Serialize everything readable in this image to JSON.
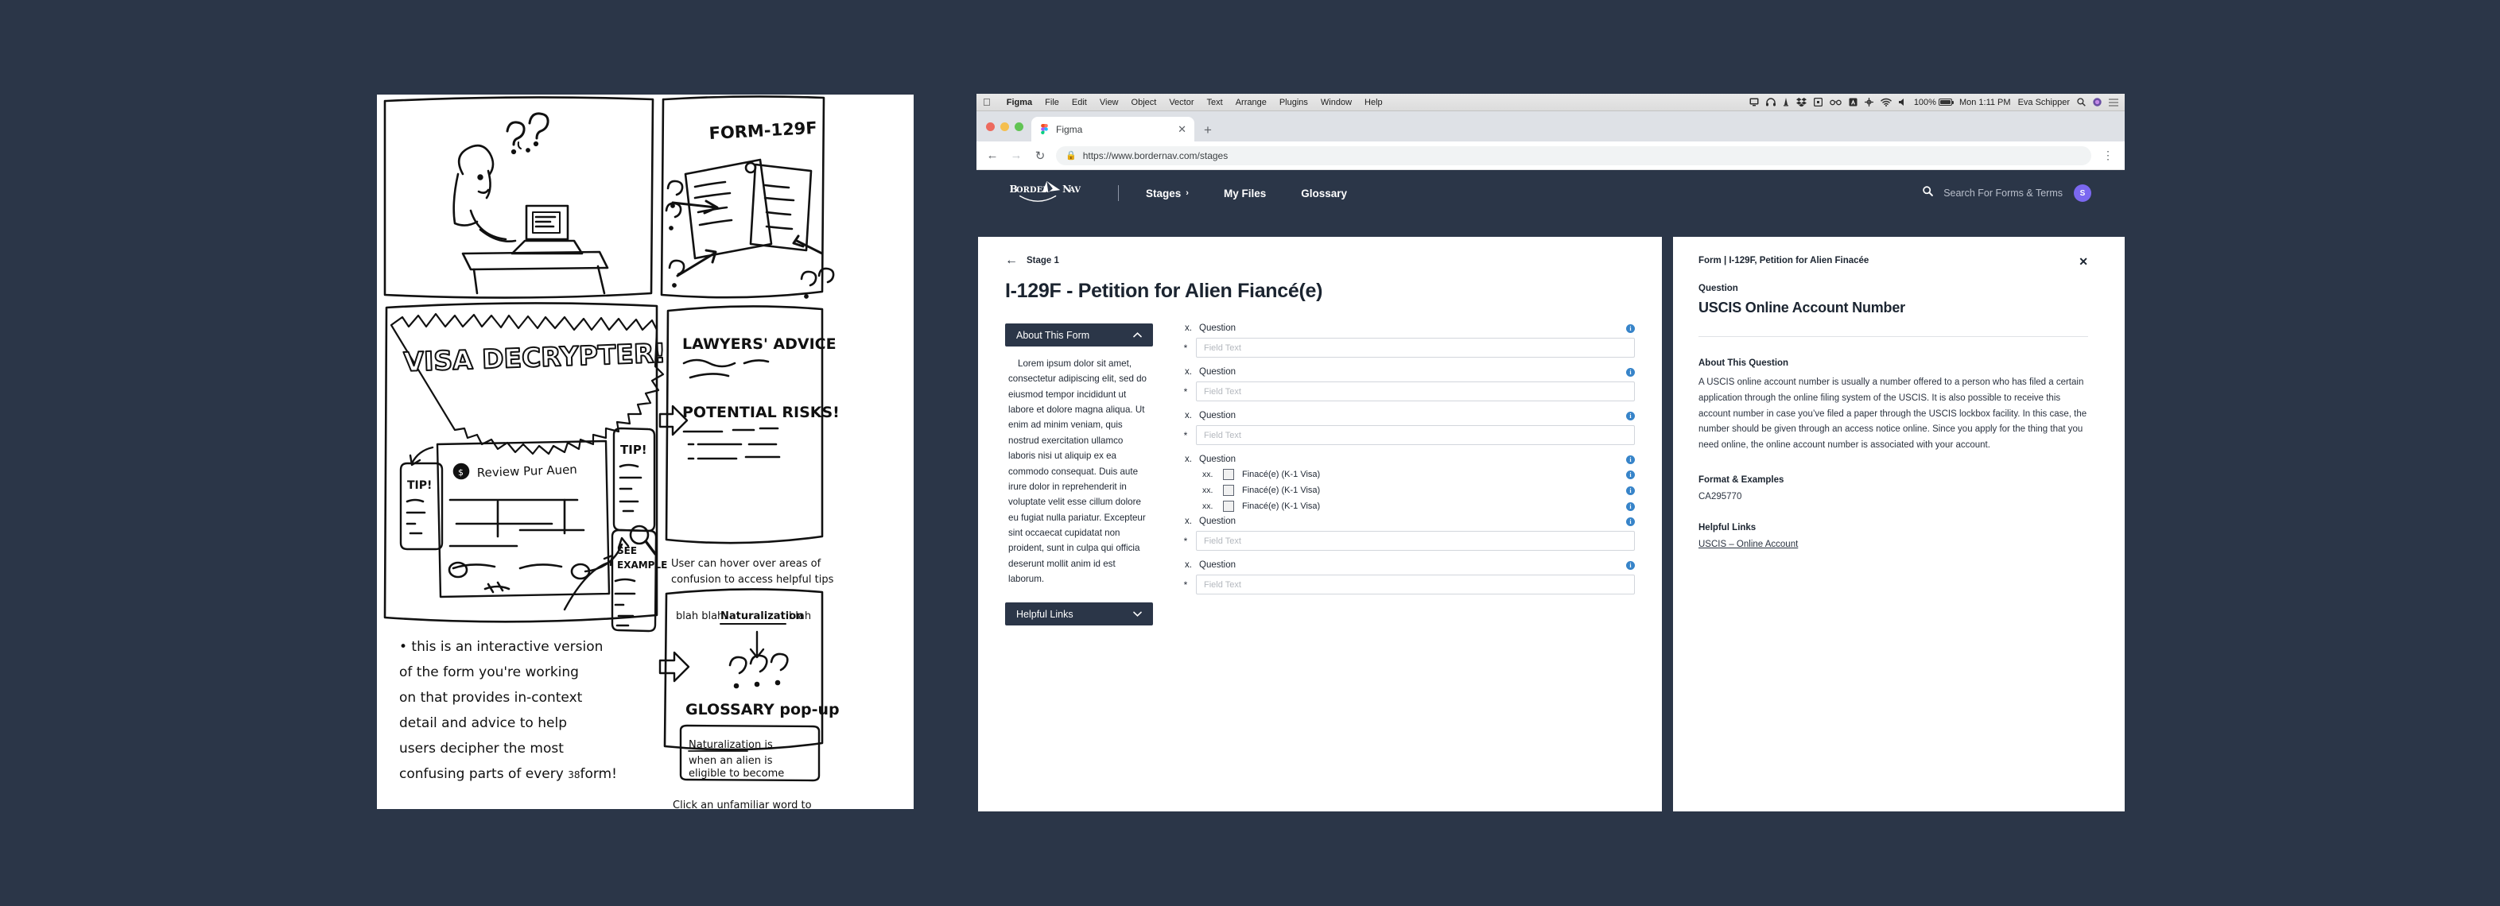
{
  "os": {
    "menubar": {
      "apple_icon": "apple-icon",
      "app_name": "Figma",
      "menus": [
        "File",
        "Edit",
        "View",
        "Object",
        "Vector",
        "Text",
        "Arrange",
        "Plugins",
        "Window",
        "Help"
      ],
      "tray_icons": [
        "display-icon",
        "headphones-icon",
        "tower-icon",
        "dropbox-icon",
        "screen-icon",
        "glasses-icon",
        "adobe-icon",
        "crosshair-icon",
        "wifi-icon",
        "volume-icon"
      ],
      "battery_percent": "100%",
      "clock": "Mon 1:11 PM",
      "user": "Eva Schipper",
      "search_icon": "search-icon",
      "siri_icon": "siri-icon",
      "controlcenter_icon": "list-icon"
    }
  },
  "browser": {
    "traffic_lights": [
      "close",
      "minimize",
      "zoom"
    ],
    "tab": {
      "title": "Figma",
      "favicon": "figma-icon",
      "close_icon": "close-icon"
    },
    "new_tab_icon": "plus-icon",
    "back_icon": "back-arrow-icon",
    "forward_icon": "forward-arrow-icon",
    "reload_icon": "reload-icon",
    "lock_icon": "lock-icon",
    "url": "https://www.bordernav.com/stages",
    "menu_icon": "kebab-menu-icon"
  },
  "appnav": {
    "logo": {
      "word_left": "BORDER",
      "word_right": "NAV",
      "icon": "paper-plane-icon"
    },
    "links": [
      {
        "label": "Stages",
        "chevron": "›"
      },
      {
        "label": "My Files",
        "chevron": ""
      },
      {
        "label": "Glossary",
        "chevron": ""
      }
    ],
    "search": {
      "icon": "search-icon",
      "placeholder": "Search For Forms & Terms"
    },
    "avatar": {
      "initial": "S",
      "color": "#7b68f0"
    }
  },
  "main": {
    "back_arrow": "←",
    "stage_label": "Stage 1",
    "form_title": "I-129F - Petition for Alien Fiancé(e)",
    "about_accordion": {
      "title": "About This Form",
      "caret": "⌃",
      "body": "Lorem ipsum dolor sit amet, consectetur adipiscing elit, sed do eiusmod tempor incididunt ut labore et dolore magna aliqua. Ut enim ad minim veniam, quis nostrud exercitation ullamco laboris nisi ut aliquip ex ea commodo consequat. Duis aute irure dolor in reprehenderit in voluptate velit esse cillum dolore eu fugiat nulla pariatur. Excepteur sint occaecat cupidatat non proident, sunt in culpa qui officia deserunt mollit anim id est laborum."
    },
    "links_accordion": {
      "title": "Helpful Links",
      "caret": "⌄"
    },
    "question_number": "x.",
    "sub_number": "xx.",
    "required_mark": "*",
    "info_icon_glyph": "i",
    "field_placeholder": "Field Text",
    "questions": [
      {
        "label": "Question",
        "type": "text"
      },
      {
        "label": "Question",
        "type": "text"
      },
      {
        "label": "Question",
        "type": "text"
      },
      {
        "label": "Question",
        "type": "checkbox",
        "options": [
          "Finacé(e) (K-1 Visa)",
          "Finacé(e) (K-1 Visa)",
          "Finacé(e) (K-1 Visa)"
        ]
      },
      {
        "label": "Question",
        "type": "text"
      },
      {
        "label": "Question",
        "type": "text"
      }
    ]
  },
  "detail_panel": {
    "breadcrumb": "Form | I-129F, Petition for Alien Finacée",
    "close_icon": "✕",
    "question_kicker": "Question",
    "question_title": "USCIS Online Account Number",
    "about_heading": "About This Question",
    "about_body": "A USCIS online account number is usually a number offered to a person who has filed a certain application through the online filing system of the USCIS. It is also possible to receive this account number in case you’ve filed a paper through the USCIS lockbox facility. In this case, the number should be given through an access notice online. Since you apply for the thing that you need online, the online account number is associated with your account.",
    "format_heading": "Format & Examples",
    "format_example": "CA295770",
    "links_heading": "Helpful Links",
    "link_label": "USCIS – Online Account"
  },
  "sketch": {
    "panel_label": "hand-drawn-storyboard",
    "panel1_caption": "person at laptop with question marks",
    "panel2_title": "FORM-129F",
    "panel3_title": "VISA DECRYPTER!",
    "panel3_tip": "TIP!",
    "panel3_see_example": "SEE EXAMPLE",
    "panel3_review": "Review Pur Auen",
    "panel4_title_a": "LAWYERS' ADVICE",
    "panel4_title_b": "POTENTIAL RISKS!",
    "panel4_caption": "User can hover over areas of confusion to access helpful tips",
    "panel5_line1": "blah blah. Naturalization blah",
    "panel5_title": "GLOSSARY pop-up",
    "panel5_def": "Naturalization is when an alien is eligible to become",
    "panel5_caption": "Click an unfamiliar word to see the definition immediately.",
    "note": "• this is an interactive version of the form you're working on that provides in-context detail and advice to help users decipher the most confusing parts of every form!",
    "page_number": "38"
  },
  "colors": {
    "canvas": "#2b3648",
    "brand_navy": "#2b3648",
    "accent_blue": "#3784c9",
    "avatar_purple": "#7b68f0"
  }
}
